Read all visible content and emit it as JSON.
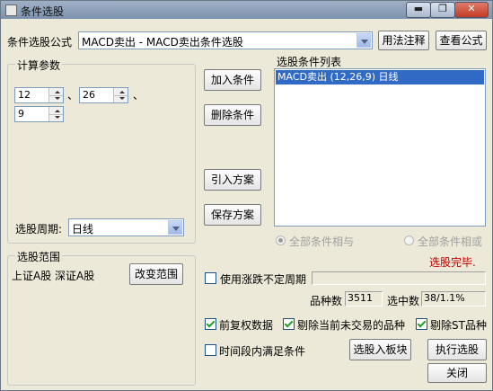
{
  "window": {
    "title": "条件选股",
    "min_label": "▬",
    "max_label": "❐",
    "close_label": "✕"
  },
  "formula": {
    "label": "条件选股公式",
    "value": "MACD卖出      - MACD卖出条件选股",
    "usage_button": "用法注释",
    "view_button": "查看公式"
  },
  "params": {
    "group_label": "计算参数",
    "p1": "12",
    "p2": "26",
    "p3": "9",
    "sep1": "、",
    "sep2": "、"
  },
  "period": {
    "label": "选股周期:",
    "value": "日线"
  },
  "actions": {
    "add_condition": "加入条件",
    "delete_condition": "删除条件",
    "import_plan": "引入方案",
    "save_plan": "保存方案"
  },
  "condition_list": {
    "label": "选股条件列表",
    "items": [
      "MACD卖出 (12,26,9) 日线"
    ]
  },
  "logic": {
    "all_and": "全部条件相与",
    "all_or": "全部条件相或"
  },
  "status": {
    "text": "选股完毕.",
    "color": "#c00000"
  },
  "range": {
    "group_label": "选股范围",
    "markets": "上证A股 深证A股",
    "change_button": "改变范围"
  },
  "options": {
    "uncertain_period": "使用涨跌不定周期",
    "stock_count_label": "品种数",
    "stock_count": "3511",
    "selected_label": "选中数",
    "selected": "38/1.1%",
    "forward_adjust": "前复权数据",
    "exclude_untraded": "剔除当前未交易的品种",
    "exclude_st": "剔除ST品种",
    "time_range": "时间段内满足条件"
  },
  "bottom": {
    "to_block": "选股入板块",
    "execute": "执行选股",
    "close": "关闭"
  },
  "colors": {
    "title_bar": "#8a9db6",
    "selection": "#316ac5",
    "background": "#ece9d8"
  }
}
